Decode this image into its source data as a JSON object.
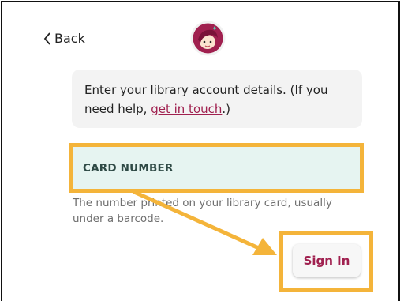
{
  "nav": {
    "back_label": "Back"
  },
  "info": {
    "text_before": "Enter your library account details. (If you need help, ",
    "link_text": "get in touch",
    "text_after": ".)"
  },
  "form": {
    "card_label": "CARD NUMBER",
    "card_hint": "The number printed on your library card, usually under a barcode.",
    "signin_label": "Sign In"
  },
  "colors": {
    "accent": "#a0204f",
    "highlight": "#f4b43a",
    "field_bg": "#e6f4f1"
  }
}
